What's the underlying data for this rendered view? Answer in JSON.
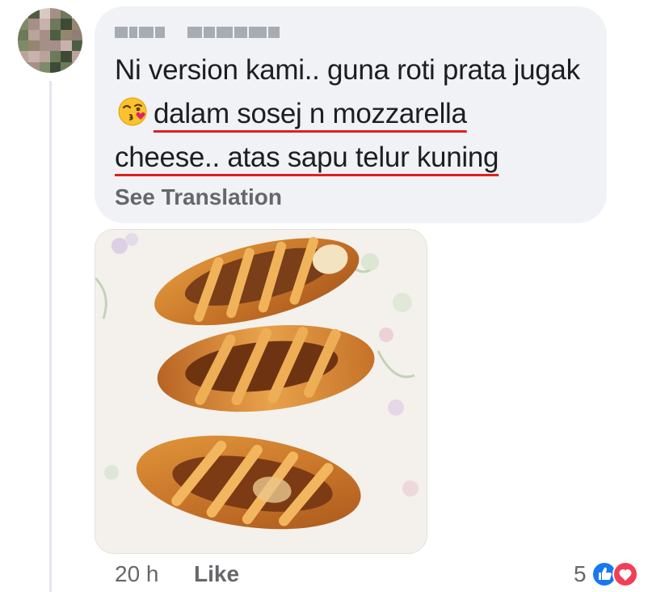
{
  "comment": {
    "author_name": "",
    "text_plain": "Ni version kami.. guna roti prata jugak",
    "text_emoji": "kissing-wink-emoji",
    "text_highlight_line1": "dalam sosej n mozzarella",
    "text_highlight_line2": "cheese.. atas sapu telur kuning",
    "see_translation": "See Translation",
    "timestamp": "20 h",
    "like_label": "Like",
    "reaction_count": "5",
    "reactions": [
      "like-reaction-icon",
      "love-reaction-icon"
    ]
  },
  "colors": {
    "bubble_bg": "#f0f2f5",
    "text": "#1c1e21",
    "secondary_text": "#65676b",
    "underline": "#e02020",
    "like_blue": "#1877f2",
    "love_red": "#f33e58"
  }
}
